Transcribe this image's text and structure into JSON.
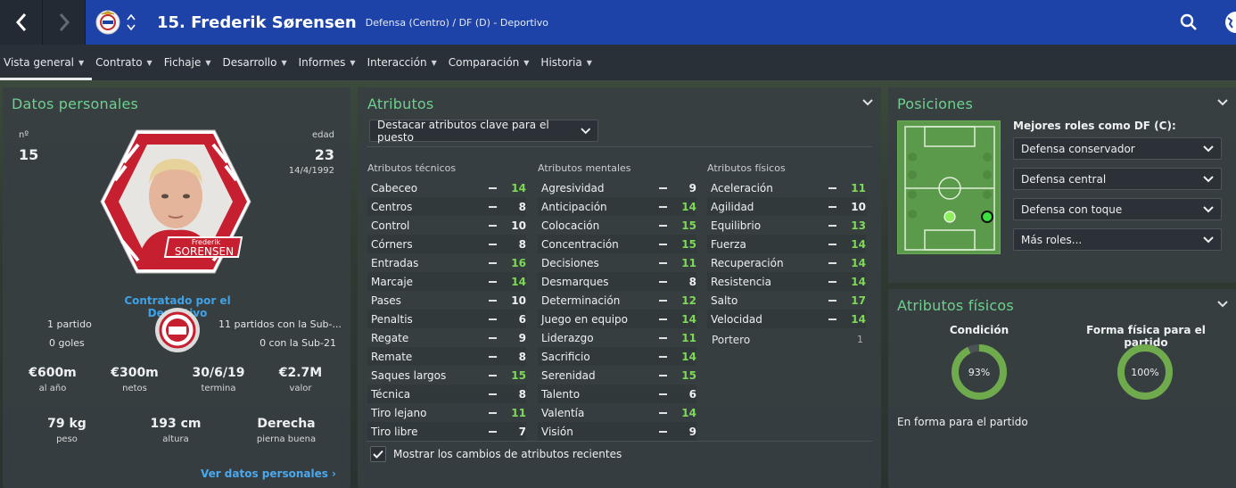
{
  "header": {
    "title": "15. Frederik Sørensen",
    "subtitle": "Defensa (Centro) / DF (D) - Deportivo",
    "back_icon": "chevron-left-icon",
    "forward_icon": "chevron-right-icon",
    "search_icon": "search-icon",
    "globe_icon": "globe-icon",
    "accent": "#1d43a8"
  },
  "tabs": [
    {
      "label": "Vista general"
    },
    {
      "label": "Contrato"
    },
    {
      "label": "Fichaje"
    },
    {
      "label": "Desarrollo"
    },
    {
      "label": "Informes"
    },
    {
      "label": "Interacción"
    },
    {
      "label": "Comparación"
    },
    {
      "label": "Historia"
    }
  ],
  "personal": {
    "title": "Datos personales",
    "number_label": "nº",
    "number": "15",
    "age_label": "edad",
    "age": "23",
    "dob": "14/4/1992",
    "card_first_name": "Frederik",
    "card_last_name": "SORENSEN",
    "signed_text": "Contratado por el Deportivo",
    "caps": "1 partido",
    "goals": "0 goles",
    "u21_caps": "11 partidos con la Sub-...",
    "u21_goals": "0 con la Sub-21",
    "stats": [
      {
        "value": "€600m",
        "label": "al año"
      },
      {
        "value": "€300m",
        "label": "netos"
      },
      {
        "value": "30/6/19",
        "label": "termina"
      },
      {
        "value": "€2.7M",
        "label": "valor"
      }
    ],
    "body": [
      {
        "value": "79 kg",
        "label": "peso"
      },
      {
        "value": "193 cm",
        "label": "altura"
      },
      {
        "value": "Derecha",
        "label": "pierna buena"
      }
    ],
    "link": "Ver datos personales"
  },
  "attributes": {
    "title": "Atributos",
    "highlight_select": "Destacar atributos clave para el puesto",
    "technical_header": "Atributos técnicos",
    "mental_header": "Atributos mentales",
    "physical_header": "Atributos físicos",
    "technical": [
      {
        "name": "Cabeceo",
        "value": "14",
        "key": true
      },
      {
        "name": "Centros",
        "value": "8",
        "key": false
      },
      {
        "name": "Control",
        "value": "10",
        "key": false
      },
      {
        "name": "Córners",
        "value": "8",
        "key": false
      },
      {
        "name": "Entradas",
        "value": "16",
        "key": true
      },
      {
        "name": "Marcaje",
        "value": "14",
        "key": true
      },
      {
        "name": "Pases",
        "value": "10",
        "key": false
      },
      {
        "name": "Penaltis",
        "value": "6",
        "key": false
      },
      {
        "name": "Regate",
        "value": "9",
        "key": false
      },
      {
        "name": "Remate",
        "value": "8",
        "key": false
      },
      {
        "name": "Saques largos",
        "value": "15",
        "key": true
      },
      {
        "name": "Técnica",
        "value": "8",
        "key": false
      },
      {
        "name": "Tiro lejano",
        "value": "11",
        "key": true
      },
      {
        "name": "Tiro libre",
        "value": "7",
        "key": false
      }
    ],
    "mental": [
      {
        "name": "Agresividad",
        "value": "9",
        "key": false
      },
      {
        "name": "Anticipación",
        "value": "14",
        "key": true
      },
      {
        "name": "Colocación",
        "value": "15",
        "key": true
      },
      {
        "name": "Concentración",
        "value": "15",
        "key": true
      },
      {
        "name": "Decisiones",
        "value": "11",
        "key": true
      },
      {
        "name": "Desmarques",
        "value": "8",
        "key": false
      },
      {
        "name": "Determinación",
        "value": "12",
        "key": true
      },
      {
        "name": "Juego en equipo",
        "value": "14",
        "key": true
      },
      {
        "name": "Liderazgo",
        "value": "11",
        "key": true
      },
      {
        "name": "Sacrificio",
        "value": "14",
        "key": true
      },
      {
        "name": "Serenidad",
        "value": "15",
        "key": true
      },
      {
        "name": "Talento",
        "value": "6",
        "key": false
      },
      {
        "name": "Valentía",
        "value": "14",
        "key": true
      },
      {
        "name": "Visión",
        "value": "9",
        "key": false
      }
    ],
    "physical": [
      {
        "name": "Aceleración",
        "value": "11",
        "key": true
      },
      {
        "name": "Agilidad",
        "value": "10",
        "key": false
      },
      {
        "name": "Equilibrio",
        "value": "13",
        "key": true
      },
      {
        "name": "Fuerza",
        "value": "14",
        "key": true
      },
      {
        "name": "Recuperación",
        "value": "14",
        "key": true
      },
      {
        "name": "Resistencia",
        "value": "14",
        "key": true
      },
      {
        "name": "Salto",
        "value": "17",
        "key": true
      },
      {
        "name": "Velocidad",
        "value": "14",
        "key": true
      }
    ],
    "goalkeeper_label": "Portero",
    "goalkeeper_value": "1",
    "show_changes": "Mostrar los cambios de atributos recientes",
    "show_changes_checked": true,
    "key_color": "#7ed957"
  },
  "positions": {
    "title": "Posiciones",
    "best_roles_label": "Mejores roles como DF (C):",
    "roles": [
      "Defensa conservador",
      "Defensa central",
      "Defensa con toque",
      "Más roles..."
    ]
  },
  "physical_panel": {
    "title": "Atributos físicos",
    "condition_label": "Condición",
    "condition_value": "93%",
    "condition_fraction": 0.93,
    "match_fitness_label": "Forma física para el partido",
    "match_fitness_value": "100%",
    "match_fitness_fraction": 1.0,
    "status": "En forma para el partido",
    "ring_color": "#6faa4d"
  }
}
